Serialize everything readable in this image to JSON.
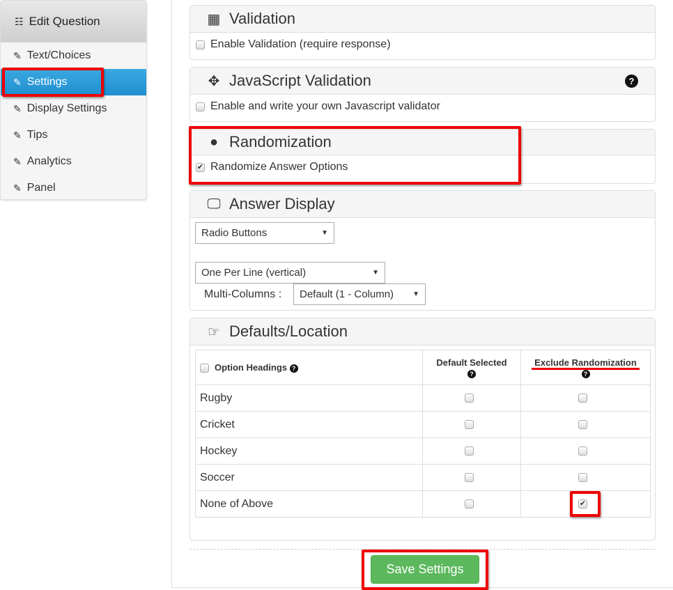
{
  "sidebar": {
    "title": "Edit Question",
    "items": [
      {
        "label": "Text/Choices"
      },
      {
        "label": "Settings",
        "active": true
      },
      {
        "label": "Display Settings"
      },
      {
        "label": "Tips"
      },
      {
        "label": "Analytics"
      },
      {
        "label": "Panel"
      }
    ]
  },
  "validation": {
    "title": "Validation",
    "checkbox": "Enable Validation (require response)",
    "checked": false
  },
  "js_validation": {
    "title": "JavaScript Validation",
    "checkbox": "Enable and write your own Javascript validator",
    "checked": false
  },
  "randomization": {
    "title": "Randomization",
    "checkbox": "Randomize Answer Options",
    "checked": true
  },
  "answer_display": {
    "title": "Answer Display",
    "type_select": "Radio Buttons",
    "layout_select": "One Per Line (vertical)",
    "multi_columns_label": "Multi-Columns :",
    "multi_columns_select": "Default (1 - Column)"
  },
  "defaults": {
    "title": "Defaults/Location",
    "headers": [
      "Option Headings",
      "Default Selected",
      "Exclude Randomization"
    ],
    "rows": [
      {
        "label": "Rugby",
        "default": false,
        "exclude": false
      },
      {
        "label": "Cricket",
        "default": false,
        "exclude": false
      },
      {
        "label": "Hockey",
        "default": false,
        "exclude": false
      },
      {
        "label": "Soccer",
        "default": false,
        "exclude": false
      },
      {
        "label": "None of Above",
        "default": false,
        "exclude": true
      }
    ]
  },
  "save_label": "Save Settings",
  "colors": {
    "active": "#2a9fd8",
    "save": "#5cb85c",
    "highlight": "#e00000"
  }
}
